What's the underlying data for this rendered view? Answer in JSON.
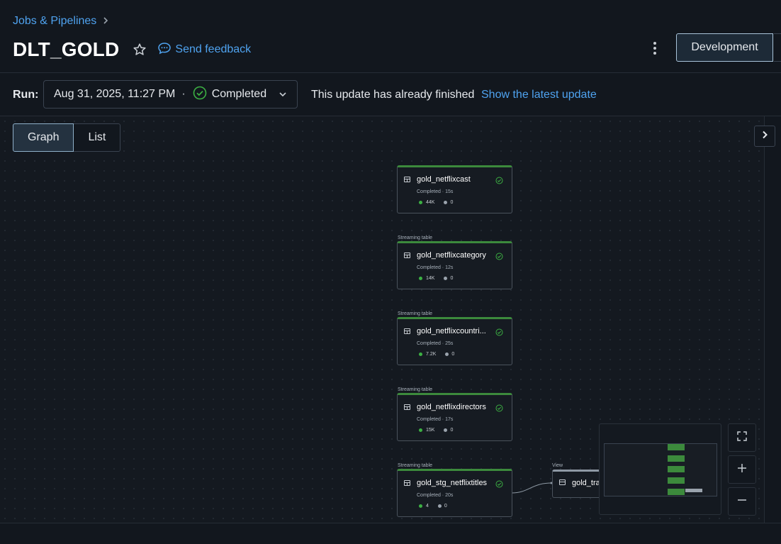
{
  "breadcrumb": {
    "parent": "Jobs & Pipelines"
  },
  "page": {
    "title": "DLT_GOLD",
    "feedback_label": "Send feedback"
  },
  "header": {
    "environment_button": "Development"
  },
  "run": {
    "label": "Run:",
    "selected_date": "Aug 31, 2025, 11:27 PM",
    "separator": "·",
    "status": "Completed",
    "finished_message": "This update has already finished",
    "latest_link": "Show the latest update"
  },
  "view_tabs": [
    {
      "label": "Graph",
      "active": true
    },
    {
      "label": "List",
      "active": false
    }
  ],
  "graph": {
    "nodes": [
      {
        "type_label": "",
        "name": "gold_netflixcast",
        "status": "Completed · 15s",
        "rows": "44K",
        "dropped": "0"
      },
      {
        "type_label": "Streaming table",
        "name": "gold_netflixcategory",
        "status": "Completed · 12s",
        "rows": "14K",
        "dropped": "0"
      },
      {
        "type_label": "Streaming table",
        "name": "gold_netflixcountri...",
        "status": "Completed · 25s",
        "rows": "7.2K",
        "dropped": "0"
      },
      {
        "type_label": "Streaming table",
        "name": "gold_netflixdirectors",
        "status": "Completed · 17s",
        "rows": "15K",
        "dropped": "0"
      },
      {
        "type_label": "Streaming table",
        "name": "gold_stg_netflixtitles",
        "status": "Completed · 20s",
        "rows": "4",
        "dropped": "0"
      }
    ],
    "view_node": {
      "type_label": "View",
      "name": "gold_tra"
    }
  },
  "icons": {
    "breadcrumb_chevron": "chevron-right-icon",
    "favorite": "star-icon",
    "feedback": "speech-bubble-icon",
    "more": "kebab-menu-icon",
    "status": "check-circle-icon",
    "dropdown": "chevron-down-icon",
    "panel_toggle": "chevron-right-icon",
    "table": "table-icon",
    "fullscreen": "fullscreen-icon",
    "zoom_in": "plus-icon",
    "zoom_out": "minus-icon"
  },
  "colors": {
    "link": "#4fa3f0",
    "success": "#3cb043",
    "node_accent": "#3c8a3c",
    "background": "#12171e"
  }
}
